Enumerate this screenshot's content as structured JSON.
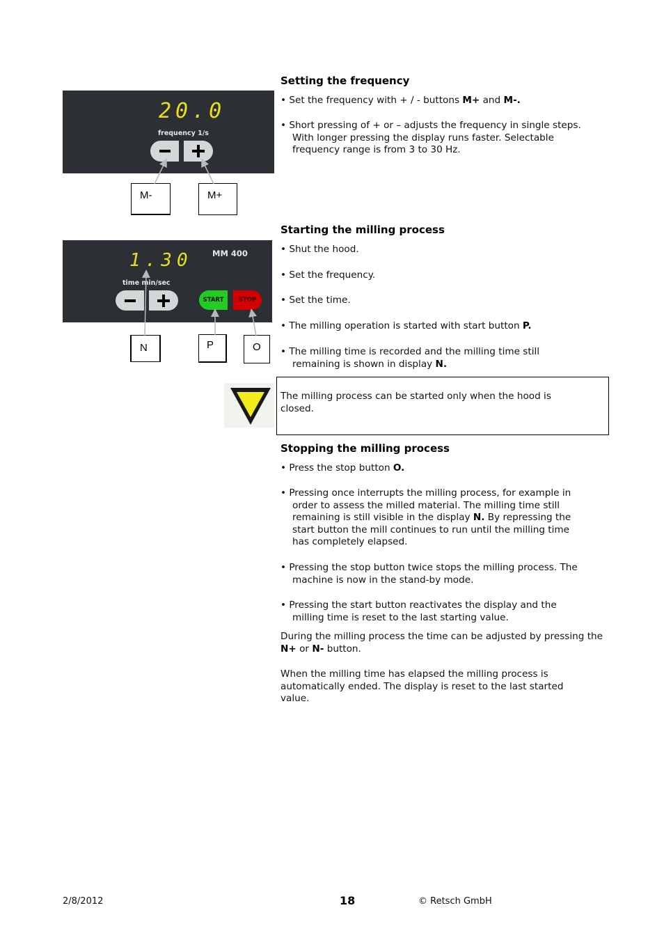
{
  "sections": {
    "frequency": {
      "title": "Setting the frequency",
      "bullets": [
        {
          "parts": [
            {
              "t": "• Set the frequency with + / - buttons "
            },
            {
              "t": "M+",
              "b": true
            },
            {
              "t": " and "
            },
            {
              "t": "M-.",
              "b": true
            }
          ]
        },
        {
          "first": "• Short pressing of + or – adjusts the frequency in single steps.",
          "cont": [
            "With longer pressing the display runs faster. Selectable",
            "frequency range is from 3 to 30 Hz."
          ]
        }
      ]
    },
    "starting": {
      "title": "Starting the milling process",
      "bullets": [
        "• Shut the hood.",
        "• Set the frequency.",
        "• Set the time.",
        {
          "parts": [
            {
              "t": "• The milling operation is started with start button "
            },
            {
              "t": "P.",
              "b": true
            }
          ]
        },
        {
          "first": "• The milling time is recorded and the milling time still",
          "cont_parts": [
            {
              "t": "remaining is shown in display "
            },
            {
              "t": "N.",
              "b": true
            }
          ]
        }
      ]
    },
    "notice": {
      "icon": "warning-triangle-icon",
      "text": "The milling process can be started only when the hood is closed."
    },
    "stopping": {
      "title": "Stopping the milling process",
      "bullets": [
        {
          "parts": [
            {
              "t": "• Press the stop button "
            },
            {
              "t": "O.",
              "b": true
            }
          ]
        },
        {
          "first": "• Pressing once interrupts the milling process, for example in",
          "cont1": "order to assess the milled material. The milling time still",
          "cont2_parts": [
            {
              "t": "remaining is still visible in the display "
            },
            {
              "t": "N.",
              "b": true
            },
            {
              "t": " By repressing the"
            }
          ],
          "cont3": "start button the mill continues to run until the milling time",
          "cont4": "has completely elapsed."
        },
        {
          "first": "• Pressing the stop button twice stops the milling process. The",
          "cont": [
            "machine is now in the stand-by mode."
          ]
        },
        {
          "first": "• Pressing the start button reactivates the display and the",
          "cont": [
            "milling time is reset to the last starting value."
          ]
        }
      ],
      "para1_parts": [
        {
          "t": "During the milling process the time can be adjusted by pressing the "
        },
        {
          "t": "N+",
          "b": true
        },
        {
          "t": " or "
        },
        {
          "t": "N-",
          "b": true
        },
        {
          "t": " button."
        }
      ],
      "para2": "When the milling time has elapsed the milling process is automatically ended. The display is reset to the last started value."
    }
  },
  "panel1": {
    "display_value": "20.0",
    "label": "frequency 1/s",
    "minus_label": "M-",
    "plus_label": "M+"
  },
  "panel2": {
    "display_value": "1.30",
    "label": "time min/sec",
    "model": "MM 400",
    "start_label": "START",
    "stop_label": "STOP",
    "callout_display": "N",
    "callout_start": "P",
    "callout_stop": "O"
  },
  "footer": {
    "date": "2/8/2012",
    "page": "18",
    "copyright": "© Retsch GmbH"
  },
  "colors": {
    "panel_bg": "#2c2f33",
    "display": "#e8e01c",
    "start": "#22cc22",
    "stop": "#d40000",
    "warning": "#f2ec1a"
  }
}
